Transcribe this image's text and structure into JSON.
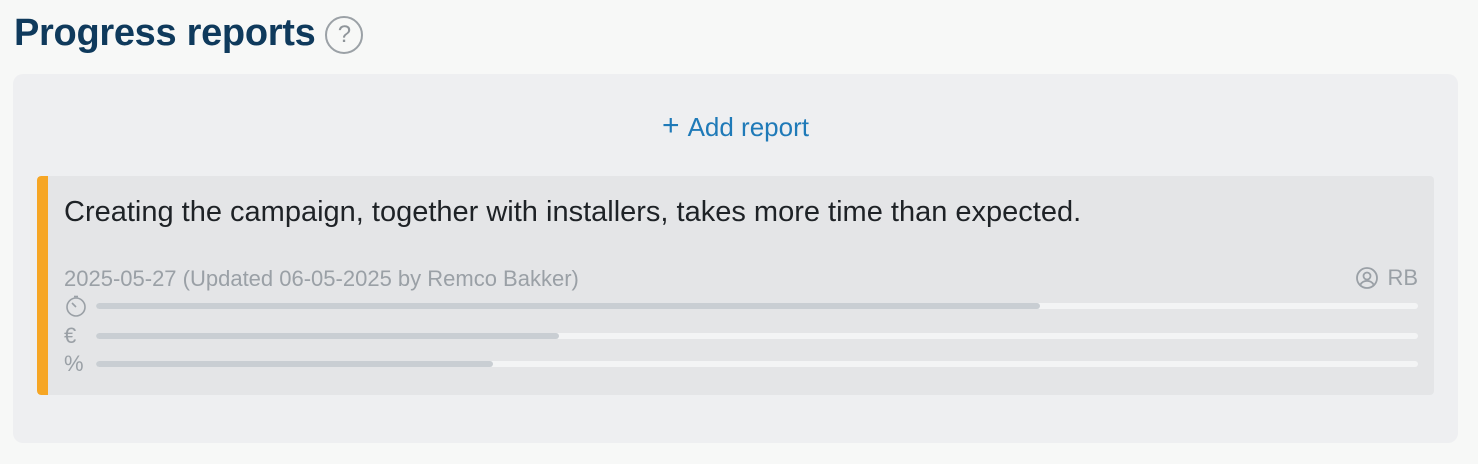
{
  "header": {
    "title": "Progress reports",
    "help_icon": "question-circle-icon",
    "help_symbol": "?"
  },
  "panel": {
    "add_report_label": "Add report",
    "add_icon": "plus-icon"
  },
  "report": {
    "accent_color": "#f6a625",
    "text": "Creating the campaign, together with installers, takes more time than expected.",
    "meta": "2025-05-27 (Updated 06-05-2025 by Remco Bakker)",
    "user_initials": "RB",
    "progress": [
      {
        "icon": "timer-icon",
        "fraction": 0.714
      },
      {
        "icon": "euro-icon",
        "symbol": "€",
        "fraction": 0.35
      },
      {
        "icon": "percent-icon",
        "symbol": "%",
        "fraction": 0.3
      }
    ]
  }
}
